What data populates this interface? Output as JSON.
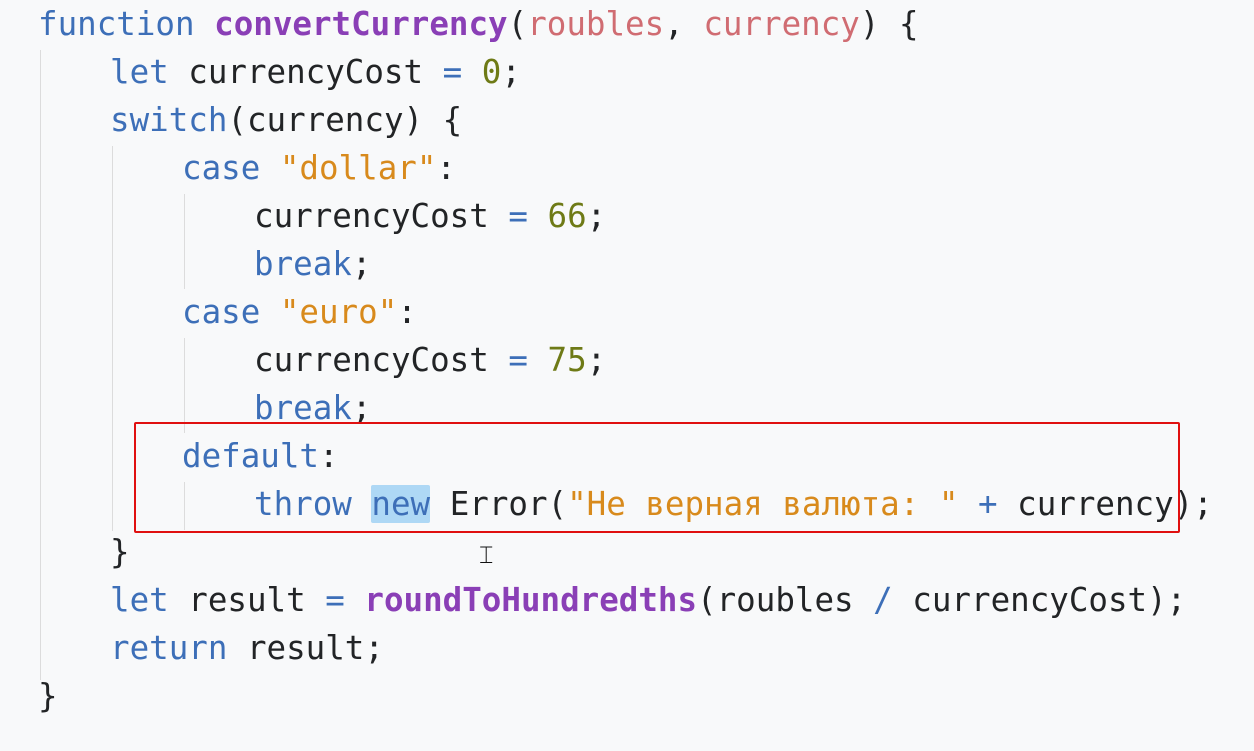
{
  "editor": {
    "language": "javascript",
    "selected_word": "new",
    "lines": [
      [
        {
          "t": "function",
          "c": "kw"
        },
        {
          "t": " ",
          "c": "ident"
        },
        {
          "t": "convertCurrency",
          "c": "fn"
        },
        {
          "t": "(",
          "c": "punct"
        },
        {
          "t": "roubles",
          "c": "param"
        },
        {
          "t": ", ",
          "c": "punct"
        },
        {
          "t": "currency",
          "c": "param"
        },
        {
          "t": ") {",
          "c": "punct"
        }
      ],
      [
        {
          "t": "let",
          "c": "kw"
        },
        {
          "t": " currencyCost ",
          "c": "ident"
        },
        {
          "t": "=",
          "c": "op"
        },
        {
          "t": " ",
          "c": "ident"
        },
        {
          "t": "0",
          "c": "num"
        },
        {
          "t": ";",
          "c": "punct"
        }
      ],
      [
        {
          "t": "switch",
          "c": "kw"
        },
        {
          "t": "(currency) {",
          "c": "punct"
        }
      ],
      [
        {
          "t": "case",
          "c": "kw"
        },
        {
          "t": " ",
          "c": "ident"
        },
        {
          "t": "\"dollar\"",
          "c": "str"
        },
        {
          "t": ":",
          "c": "punct"
        }
      ],
      [
        {
          "t": "currencyCost ",
          "c": "ident"
        },
        {
          "t": "=",
          "c": "op"
        },
        {
          "t": " ",
          "c": "ident"
        },
        {
          "t": "66",
          "c": "num"
        },
        {
          "t": ";",
          "c": "punct"
        }
      ],
      [
        {
          "t": "break",
          "c": "kw"
        },
        {
          "t": ";",
          "c": "punct"
        }
      ],
      [
        {
          "t": "case",
          "c": "kw"
        },
        {
          "t": " ",
          "c": "ident"
        },
        {
          "t": "\"euro\"",
          "c": "str"
        },
        {
          "t": ":",
          "c": "punct"
        }
      ],
      [
        {
          "t": "currencyCost ",
          "c": "ident"
        },
        {
          "t": "=",
          "c": "op"
        },
        {
          "t": " ",
          "c": "ident"
        },
        {
          "t": "75",
          "c": "num"
        },
        {
          "t": ";",
          "c": "punct"
        }
      ],
      [
        {
          "t": "break",
          "c": "kw"
        },
        {
          "t": ";",
          "c": "punct"
        }
      ],
      [
        {
          "t": "default",
          "c": "kw"
        },
        {
          "t": ":",
          "c": "punct"
        }
      ],
      [
        {
          "t": "throw",
          "c": "kw"
        },
        {
          "t": " ",
          "c": "ident"
        },
        {
          "t": "new",
          "c": "kw sel"
        },
        {
          "t": " Error(",
          "c": "ident"
        },
        {
          "t": "\"Не верная валюта: \"",
          "c": "str"
        },
        {
          "t": " ",
          "c": "ident"
        },
        {
          "t": "+",
          "c": "op"
        },
        {
          "t": " currency);",
          "c": "ident"
        }
      ],
      [
        {
          "t": "}",
          "c": "punct"
        }
      ],
      [
        {
          "t": "let",
          "c": "kw"
        },
        {
          "t": " result ",
          "c": "ident"
        },
        {
          "t": "=",
          "c": "op"
        },
        {
          "t": " ",
          "c": "ident"
        },
        {
          "t": "roundToHundredths",
          "c": "fn"
        },
        {
          "t": "(roubles ",
          "c": "ident"
        },
        {
          "t": "/",
          "c": "op"
        },
        {
          "t": " currencyCost);",
          "c": "ident"
        }
      ],
      [
        {
          "t": "return",
          "c": "kw"
        },
        {
          "t": " result;",
          "c": "ident"
        }
      ],
      [
        {
          "t": "}",
          "c": "punct"
        }
      ]
    ]
  },
  "colors": {
    "background": "#f8f9fa",
    "keyword": "#3d6fb8",
    "function_name": "#8a3fb6",
    "parameter": "#d06c72",
    "number": "#6e7a16",
    "string": "#d88a1c",
    "selection": "#aed8f5",
    "annotation_box": "#e01010"
  },
  "cursor_icon": "text-cursor-icon"
}
